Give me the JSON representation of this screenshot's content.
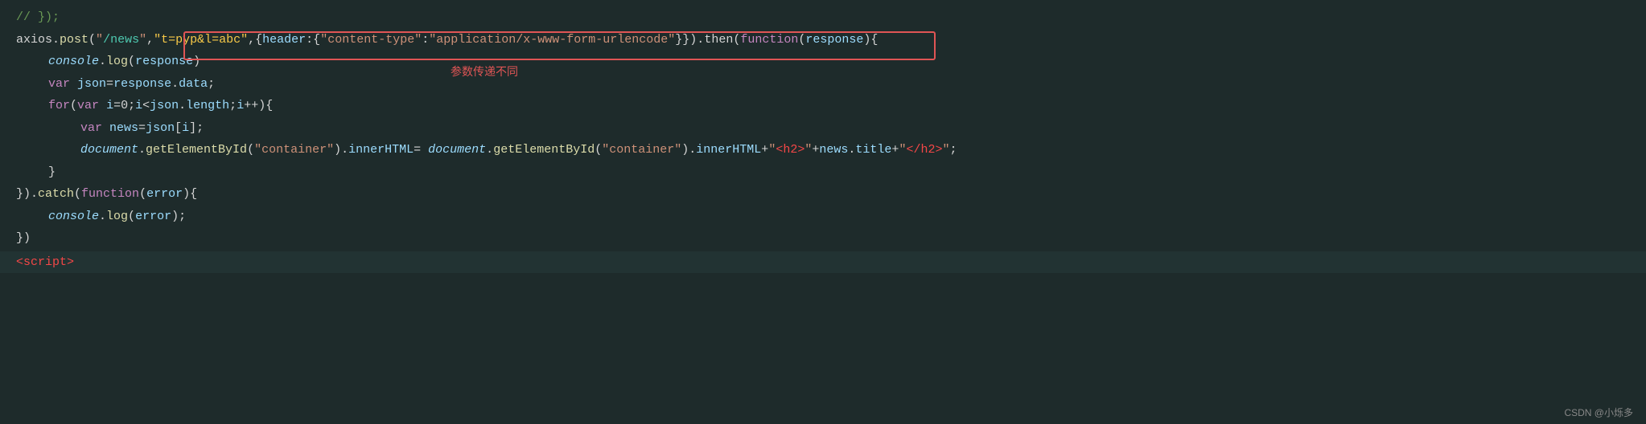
{
  "watermark": "CSDN @小烁多",
  "annotation": "参数传递不同",
  "lines": [
    {
      "id": "line1",
      "content": "// });"
    },
    {
      "id": "line2",
      "highlighted": true,
      "content": "axios.post(\"/news\",\"t=pyp&l=abc\",{header:{\"content-type\":\"application/x-www-form-urlencode\"}}).then(function(response){"
    },
    {
      "id": "line3",
      "indent": 1,
      "content": "console.log(response)"
    },
    {
      "id": "line4",
      "indent": 1,
      "content": "var json=response.data;"
    },
    {
      "id": "line5",
      "indent": 1,
      "content": "for(var i=0;i<json.length;i++){"
    },
    {
      "id": "line6",
      "indent": 2,
      "content": "var news=json[i];"
    },
    {
      "id": "line7",
      "indent": 2,
      "content": "document.getElementById(\"container\").innerHTML= document.getElementById(\"container\").innerHTML+\"<h2>\"+news.title+\"</h2>\";"
    },
    {
      "id": "line8",
      "indent": 1,
      "content": "}"
    },
    {
      "id": "line9",
      "content": "}).catch(function(error){"
    },
    {
      "id": "line10",
      "indent": 1,
      "content": "console.log(error);"
    },
    {
      "id": "line11",
      "content": "})"
    },
    {
      "id": "line12",
      "content": "<script>"
    }
  ]
}
